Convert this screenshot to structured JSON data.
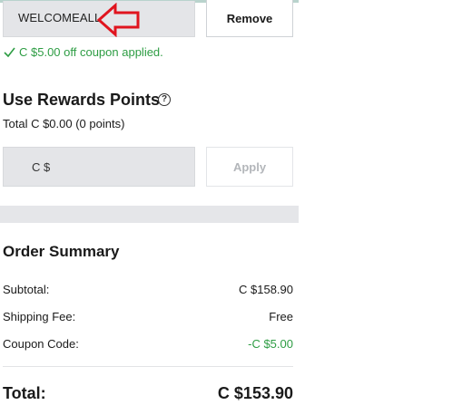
{
  "coupon": {
    "code": "WELCOMEALL",
    "remove_label": "Remove",
    "applied_message": "C $5.00 off coupon applied."
  },
  "rewards": {
    "title": "Use Rewards Points",
    "total_text": "Total C $0.00 (0 points)",
    "currency_prefix": "C $",
    "apply_label": "Apply"
  },
  "summary": {
    "title": "Order Summary",
    "rows": [
      {
        "label": "Subtotal:",
        "value": "C $158.90"
      },
      {
        "label": "Shipping Fee:",
        "value": "Free"
      },
      {
        "label": "Coupon Code:",
        "value": "-C $5.00"
      }
    ],
    "total_label": "Total:",
    "total_value": "C $153.90"
  },
  "colors": {
    "success": "#2e9d44",
    "annotation_arrow": "#e0141e",
    "field_bg": "#e4e5e8"
  },
  "icons": [
    "left-arrow-icon",
    "check-icon",
    "help-icon"
  ]
}
